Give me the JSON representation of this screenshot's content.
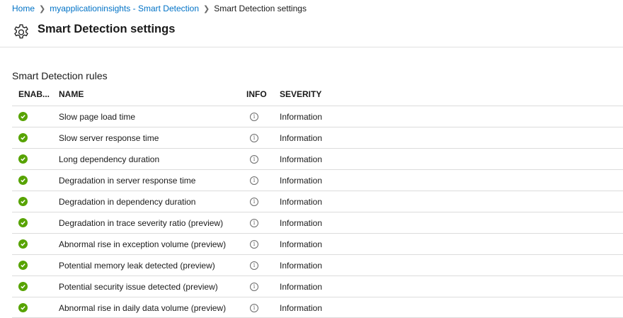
{
  "breadcrumb": {
    "home": "Home",
    "parent": "myapplicationinsights - Smart Detection",
    "current": "Smart Detection settings"
  },
  "header": {
    "title": "Smart Detection settings",
    "icon": "gear-icon"
  },
  "section": {
    "title": "Smart Detection rules"
  },
  "table": {
    "columns": {
      "enabled": "ENAB...",
      "name": "NAME",
      "info": "INFO",
      "severity": "SEVERITY"
    },
    "rows": [
      {
        "name": "Slow page load time",
        "severity": "Information",
        "enabled": true
      },
      {
        "name": "Slow server response time",
        "severity": "Information",
        "enabled": true
      },
      {
        "name": "Long dependency duration",
        "severity": "Information",
        "enabled": true
      },
      {
        "name": "Degradation in server response time",
        "severity": "Information",
        "enabled": true
      },
      {
        "name": "Degradation in dependency duration",
        "severity": "Information",
        "enabled": true
      },
      {
        "name": "Degradation in trace severity ratio (preview)",
        "severity": "Information",
        "enabled": true
      },
      {
        "name": "Abnormal rise in exception volume (preview)",
        "severity": "Information",
        "enabled": true
      },
      {
        "name": "Potential memory leak detected (preview)",
        "severity": "Information",
        "enabled": true
      },
      {
        "name": "Potential security issue detected (preview)",
        "severity": "Information",
        "enabled": true
      },
      {
        "name": "Abnormal rise in daily data volume (preview)",
        "severity": "Information",
        "enabled": true
      }
    ]
  },
  "colors": {
    "link": "#0072c6",
    "enabled_check": "#57a300",
    "row_border": "#dcdcdc"
  }
}
